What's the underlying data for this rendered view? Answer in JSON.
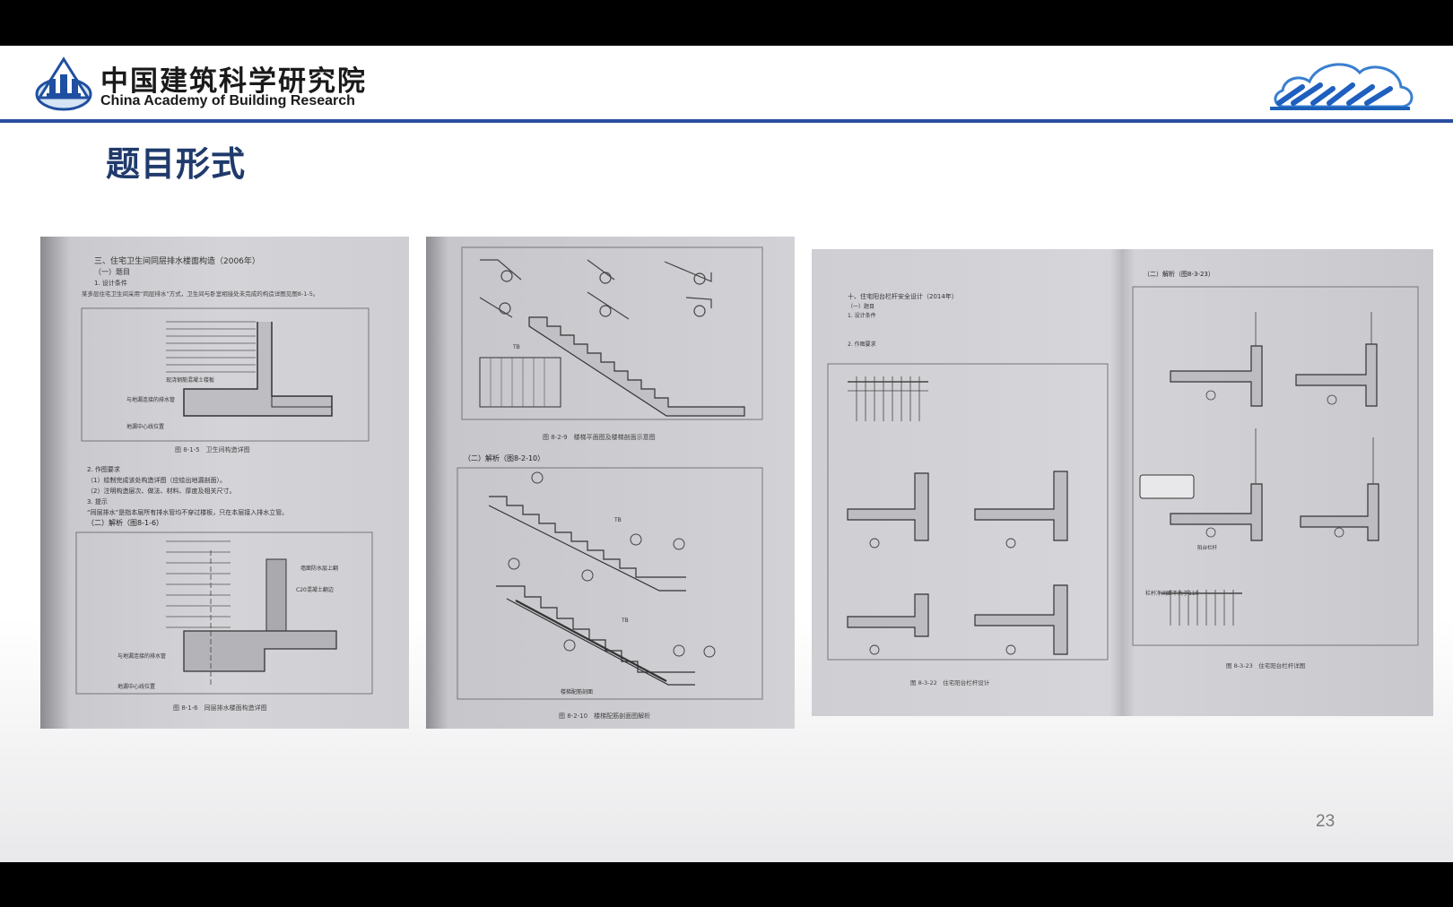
{
  "header": {
    "org_name_cn": "中国建筑科学研究院",
    "org_name_en": "China Academy of Building Research",
    "logo_icon": "cabr-logo-icon",
    "partner_logo_icon": "building-alliance-logo-icon",
    "rule_color": "#2a4f9e"
  },
  "slide": {
    "title": "题目形式",
    "page_number": "23"
  },
  "photos": [
    {
      "heading": "三、住宅卫生间同层排水楼面构造（2006年）",
      "sub1": "（一）题目",
      "sub2": "1. 设计条件",
      "body": "某多层住宅卫生间采用“同层排水”方式，卫生间与卧室相接处未完成的构造详图见图8-1-5。",
      "fig1_caption": "图 8-1-5　卫生间构造详图",
      "sec2": "2. 作图要求",
      "req1": "（1）绘制完成该处构造详图（应绘出地漏剖面）。",
      "req2": "（2）注明构造层次、做法、材料、厚度及相关尺寸。",
      "sec3": "3. 提示",
      "hint": "“同层排水”是指本层所有排水管均不穿过楼板，只在本层接入排水立管。",
      "analysis": "（二）解析（图8-1-6）",
      "fig2_caption": "图 8-1-6　同层排水楼面构造详图"
    },
    {
      "fig1_caption": "图 8-2-9　楼梯平面图及楼梯剖面示意图",
      "analysis": "（二）解析（图8-2-10）",
      "fig2_caption": "图 8-2-10　楼梯配筋剖面图解析",
      "label_tb": "TB",
      "sub_label": "楼梯配筋剖面"
    },
    {
      "heading": "十、住宅阳台栏杆安全设计（2014年）",
      "sub1": "（一）题目",
      "sec1": "1. 设计条件",
      "sec2": "2. 作图要求",
      "fig1_caption": "图 8-3-22　住宅阳台栏杆设计",
      "analysis": "（二）解析（图8-3-23）",
      "fig2_caption": "图 8-3-23　住宅阳台栏杆详图",
      "railing_label": "阳台栏杆",
      "note": "栏杆净间距不大于110"
    }
  ]
}
